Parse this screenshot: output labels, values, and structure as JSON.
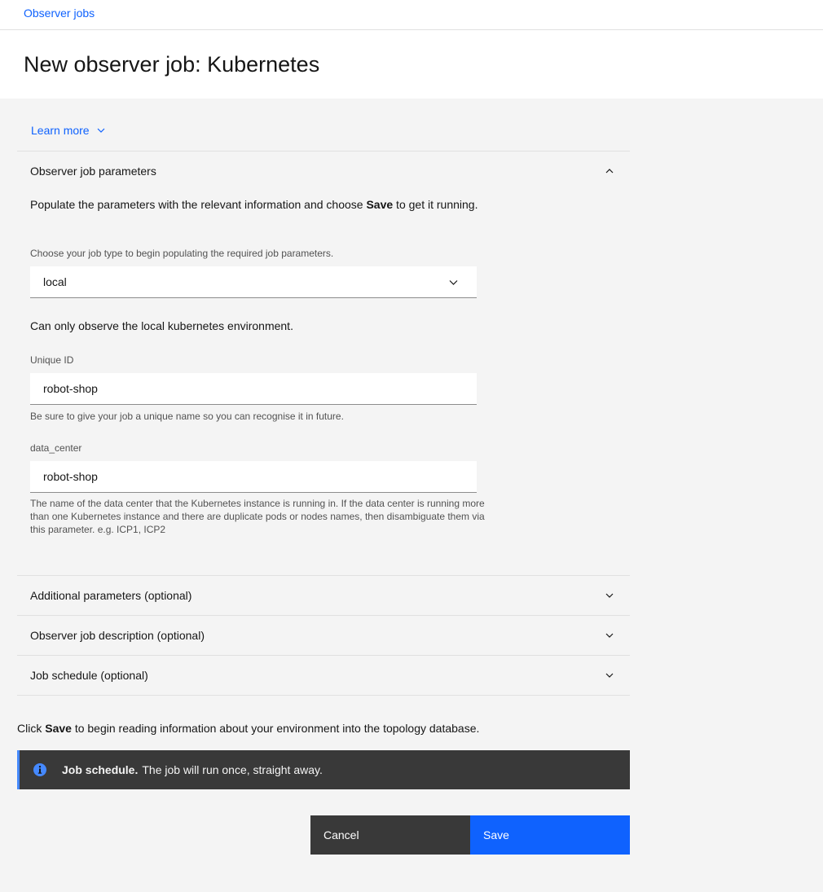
{
  "breadcrumb": {
    "link": "Observer jobs"
  },
  "page_title": "New observer job: Kubernetes",
  "learn_more": "Learn more",
  "params_section": {
    "title": "Observer job parameters",
    "intro_before": "Populate the parameters with the relevant information and choose ",
    "intro_bold": "Save",
    "intro_after": " to get it running.",
    "job_type_label": "Choose your job type to begin populating the required job parameters.",
    "job_type_value": "local",
    "job_type_desc": "Can only observe the local kubernetes environment.",
    "unique_id_label": "Unique ID",
    "unique_id_value": "robot-shop",
    "unique_id_helper": "Be sure to give your job a unique name so you can recognise it in future.",
    "data_center_label": "data_center",
    "data_center_value": "robot-shop",
    "data_center_helper": "The name of the data center that the Kubernetes instance is running in. If the data center is running more than one Kubernetes instance and there are duplicate pods or nodes names, then disambiguate them via this parameter. e.g. ICP1, ICP2"
  },
  "accordions": [
    {
      "title": "Additional parameters (optional)"
    },
    {
      "title": "Observer job description (optional)"
    },
    {
      "title": "Job schedule (optional)"
    }
  ],
  "footer_text": {
    "before": "Click ",
    "bold": "Save",
    "after": " to begin reading information about your environment into the topology database."
  },
  "notification": {
    "title": "Job schedule.",
    "message": "The job will run once, straight away.",
    "icon": "info-icon",
    "accent_color": "#4589ff"
  },
  "buttons": {
    "cancel": "Cancel",
    "save": "Save"
  },
  "colors": {
    "primary": "#0f62fe",
    "dark": "#393939",
    "background": "#f4f4f4"
  }
}
